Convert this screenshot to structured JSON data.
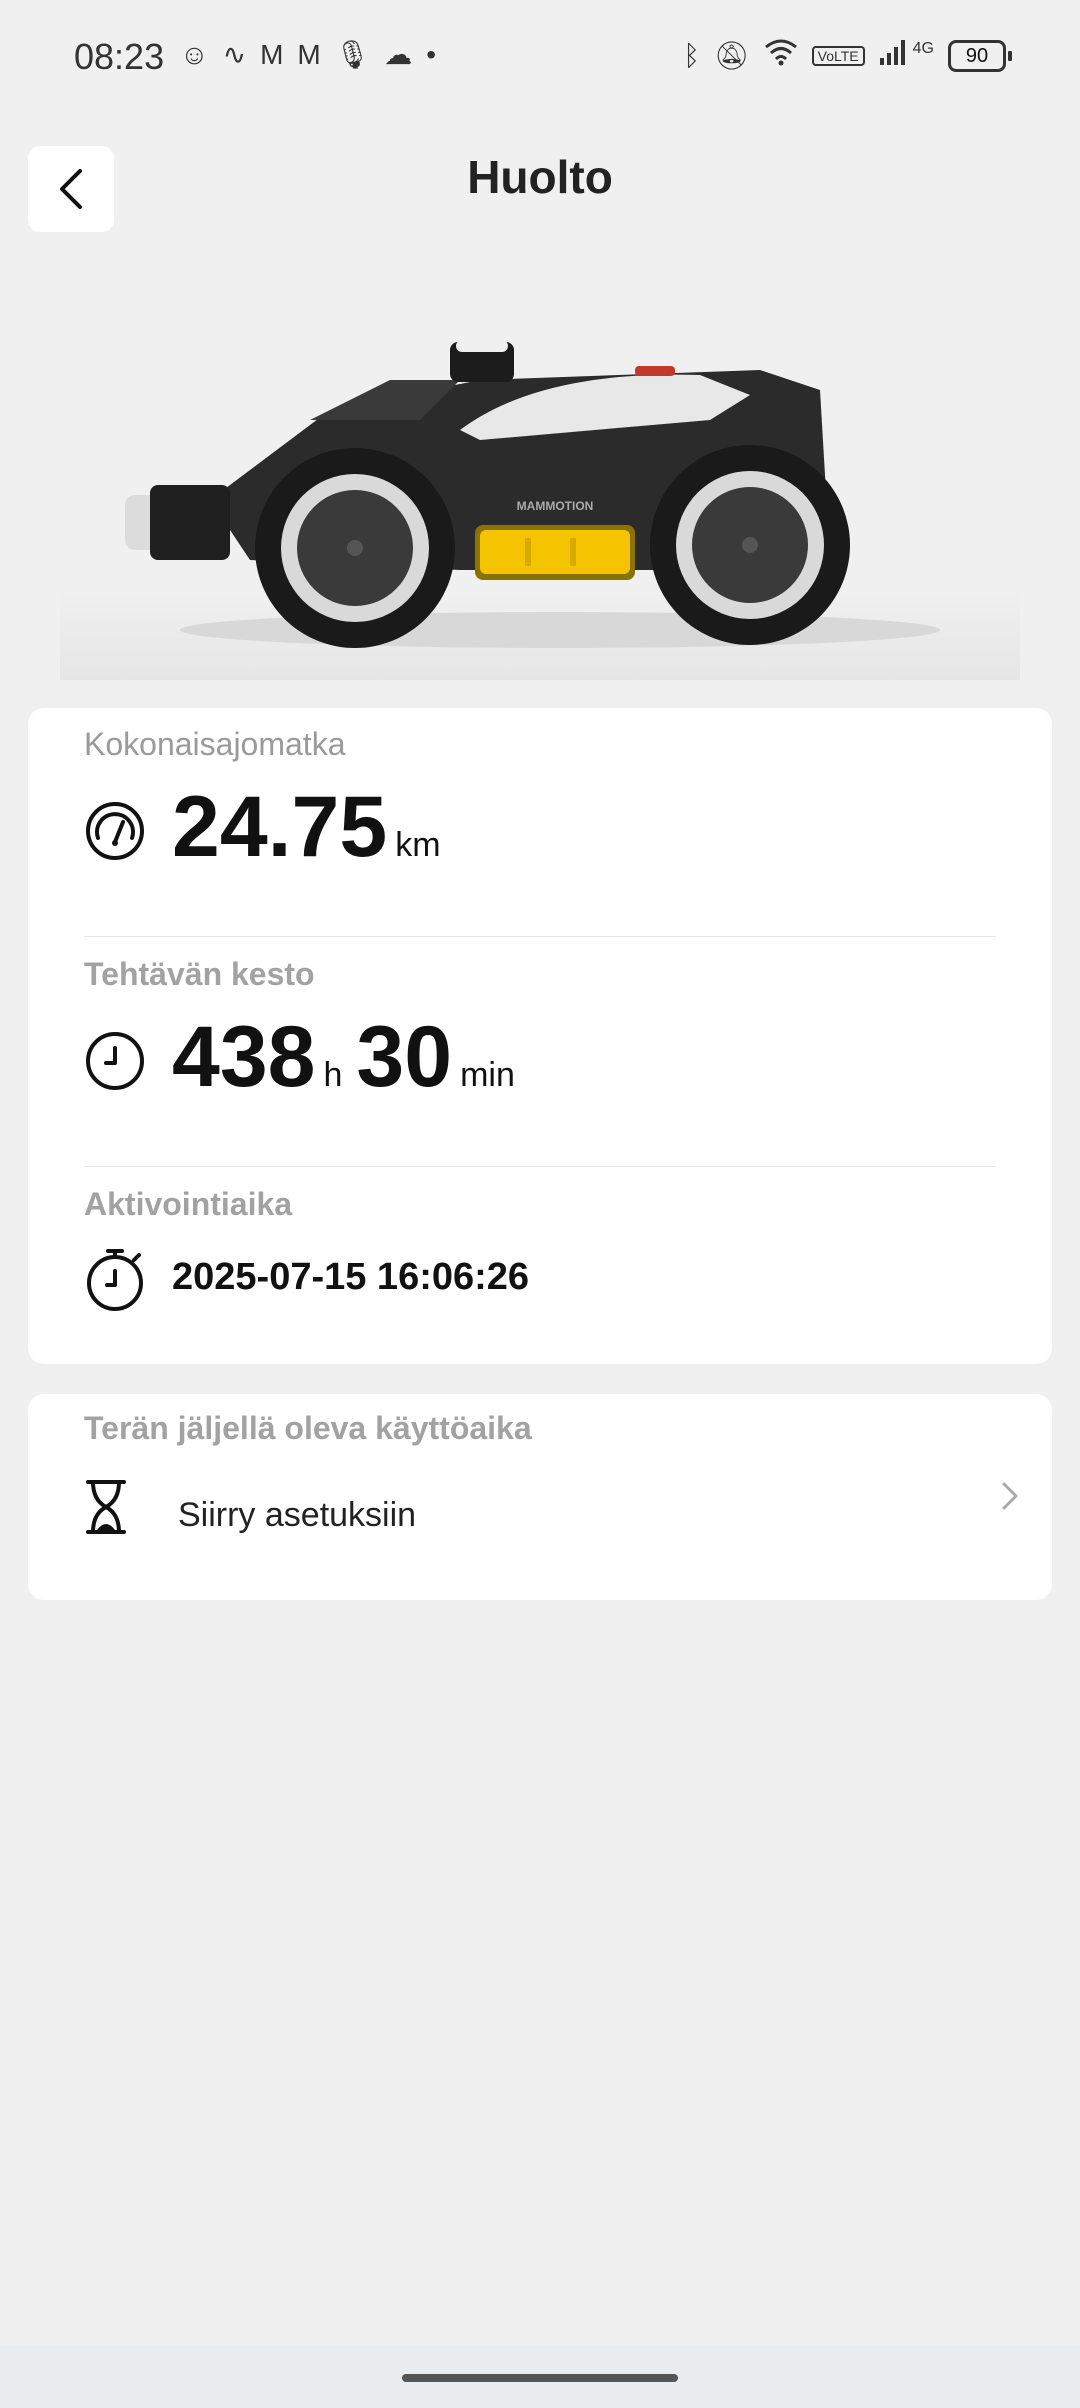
{
  "status_bar": {
    "time": "08:23",
    "left_icons": [
      "cat-notification-icon",
      "mammotion-notification-icon",
      "gmail-icon",
      "gmail-icon",
      "microphone-icon",
      "cloud-icon",
      "dot-icon"
    ],
    "right_icons": [
      "bluetooth-icon",
      "mute-bell-icon",
      "wifi-icon",
      "volte-icon",
      "signal-icon"
    ],
    "volte_label": "VoLTE",
    "network_label": "4G",
    "battery_level": "90"
  },
  "header": {
    "title": "Huolto"
  },
  "stats": {
    "distance_label": "Kokonaisajomatka",
    "distance_value": "24.75",
    "distance_unit": "km",
    "duration_label": "Tehtävän kesto",
    "duration_hours": "438",
    "duration_hours_unit": "h",
    "duration_minutes": "30",
    "duration_minutes_unit": "min",
    "activation_label": "Aktivointiaika",
    "activation_value": "2025-07-15 16:06:26"
  },
  "blade": {
    "label": "Terän jäljellä oleva käyttöaika",
    "link_text": "Siirry asetuksiin"
  },
  "hero": {
    "brand_text": "MAMMOTION"
  },
  "colors": {
    "background": "#f0f0f0",
    "card": "#ffffff",
    "accent_yellow": "#f5c400"
  }
}
